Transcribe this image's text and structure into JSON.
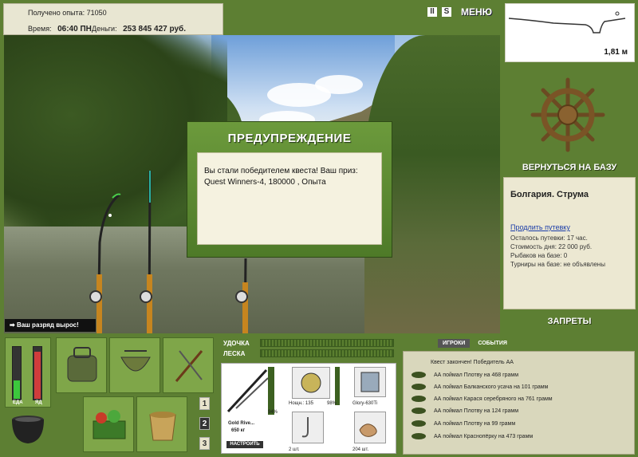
{
  "info": {
    "exp_label": "Получено опыта:",
    "exp_value": "71050",
    "time_label": "Время:",
    "time_value": "06:40 ПН",
    "money_label": "Деньги:",
    "money_value": "253 845 427 руб."
  },
  "top": {
    "pause_icon": "II",
    "sound_icon": "S",
    "menu_label": "МЕНЮ"
  },
  "depth": {
    "value": "1,81 м"
  },
  "right": {
    "return_label": "ВЕРНУТЬСЯ НА БАЗУ",
    "base_title": "Болгария. Струма",
    "extend_link": "Продлить путевку",
    "lines": [
      "Осталось путевки: 17 час.",
      "Стоимость дня: 22 000 руб.",
      "Рыбаков на базе: 0",
      "Турниры на базе: не объявлены"
    ],
    "forbid_label": "ЗАПРЕТЫ"
  },
  "dialog": {
    "title": "ПРЕДУПРЕЖДЕНИЕ",
    "text": "Вы стали победителем квеста! Ваш приз: Quest Winners-4, 180000 , Опыта"
  },
  "rank": {
    "label": "Ваш разряд вырос!"
  },
  "meters": {
    "food_label": "ЕДА",
    "poison_label": "ЯД",
    "food_level": 0.35,
    "poison_level": 0.9
  },
  "numbers": [
    "1",
    "2",
    "3"
  ],
  "tackle": {
    "rod_label": "УДОЧКА",
    "line_label": "ЛЕСКА"
  },
  "gear": {
    "rod_name": "Gold Rive...",
    "rod_weight": "650 кг",
    "rod_pct": "94%",
    "reel_name": "Нощн.: 135",
    "reel_pct": "98%",
    "lure_name": "Glory-630Ti",
    "hook_count": "2 шт.",
    "bait_count": "204 шт.",
    "setup_label": "НАСТРОИТЬ"
  },
  "events": {
    "tab_players": "ИГРОКИ",
    "tab_events": "СОБЫТИЯ",
    "header": "Квест закончен! Победитель АА",
    "items": [
      "АА поймал Плотву на 468 грамм",
      "АА поймал Балканского усача на 101 грамм",
      "АА поймал Карася серебряного на 761 грамм",
      "АА поймал Плотву на 124 грамм",
      "АА поймал Плотву на 99 грамм",
      "АА поймал Краснопёрку на 473 грамм"
    ]
  }
}
